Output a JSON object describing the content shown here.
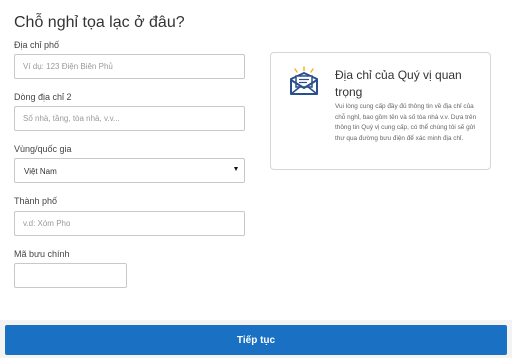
{
  "page": {
    "title": "Chỗ nghỉ tọa lạc ở đâu?"
  },
  "form": {
    "street": {
      "label": "Địa chỉ phố",
      "placeholder": "Ví dụ: 123 Điện Biên Phủ",
      "value": ""
    },
    "line2": {
      "label": "Dòng địa chỉ 2",
      "placeholder": "Số nhà, tầng, tòa nhà, v.v...",
      "value": ""
    },
    "country": {
      "label": "Vùng/quốc gia",
      "selected": "Việt Nam"
    },
    "city": {
      "label": "Thành phố",
      "placeholder": "v.d: Xóm Pho",
      "value": ""
    },
    "postal": {
      "label": "Mã bưu chính",
      "placeholder": "",
      "value": ""
    }
  },
  "info": {
    "icon": "envelope-letter-icon",
    "title": "Địa chỉ của Quý vị quan trọng",
    "body": "Vui lòng cung cấp đầy đủ thông tin về địa chỉ của chỗ nghỉ, bao gồm tên và số tòa nhà v.v. Dựa trên thông tin Quý vị cung cấp, có thể chúng tôi sẽ gửi thư qua đường bưu điện để xác minh địa chỉ."
  },
  "footer": {
    "continue_label": "Tiếp tục"
  },
  "colors": {
    "primary": "#1a70c2",
    "icon_blue": "#2a4f8a",
    "icon_yellow": "#f3b61c"
  }
}
